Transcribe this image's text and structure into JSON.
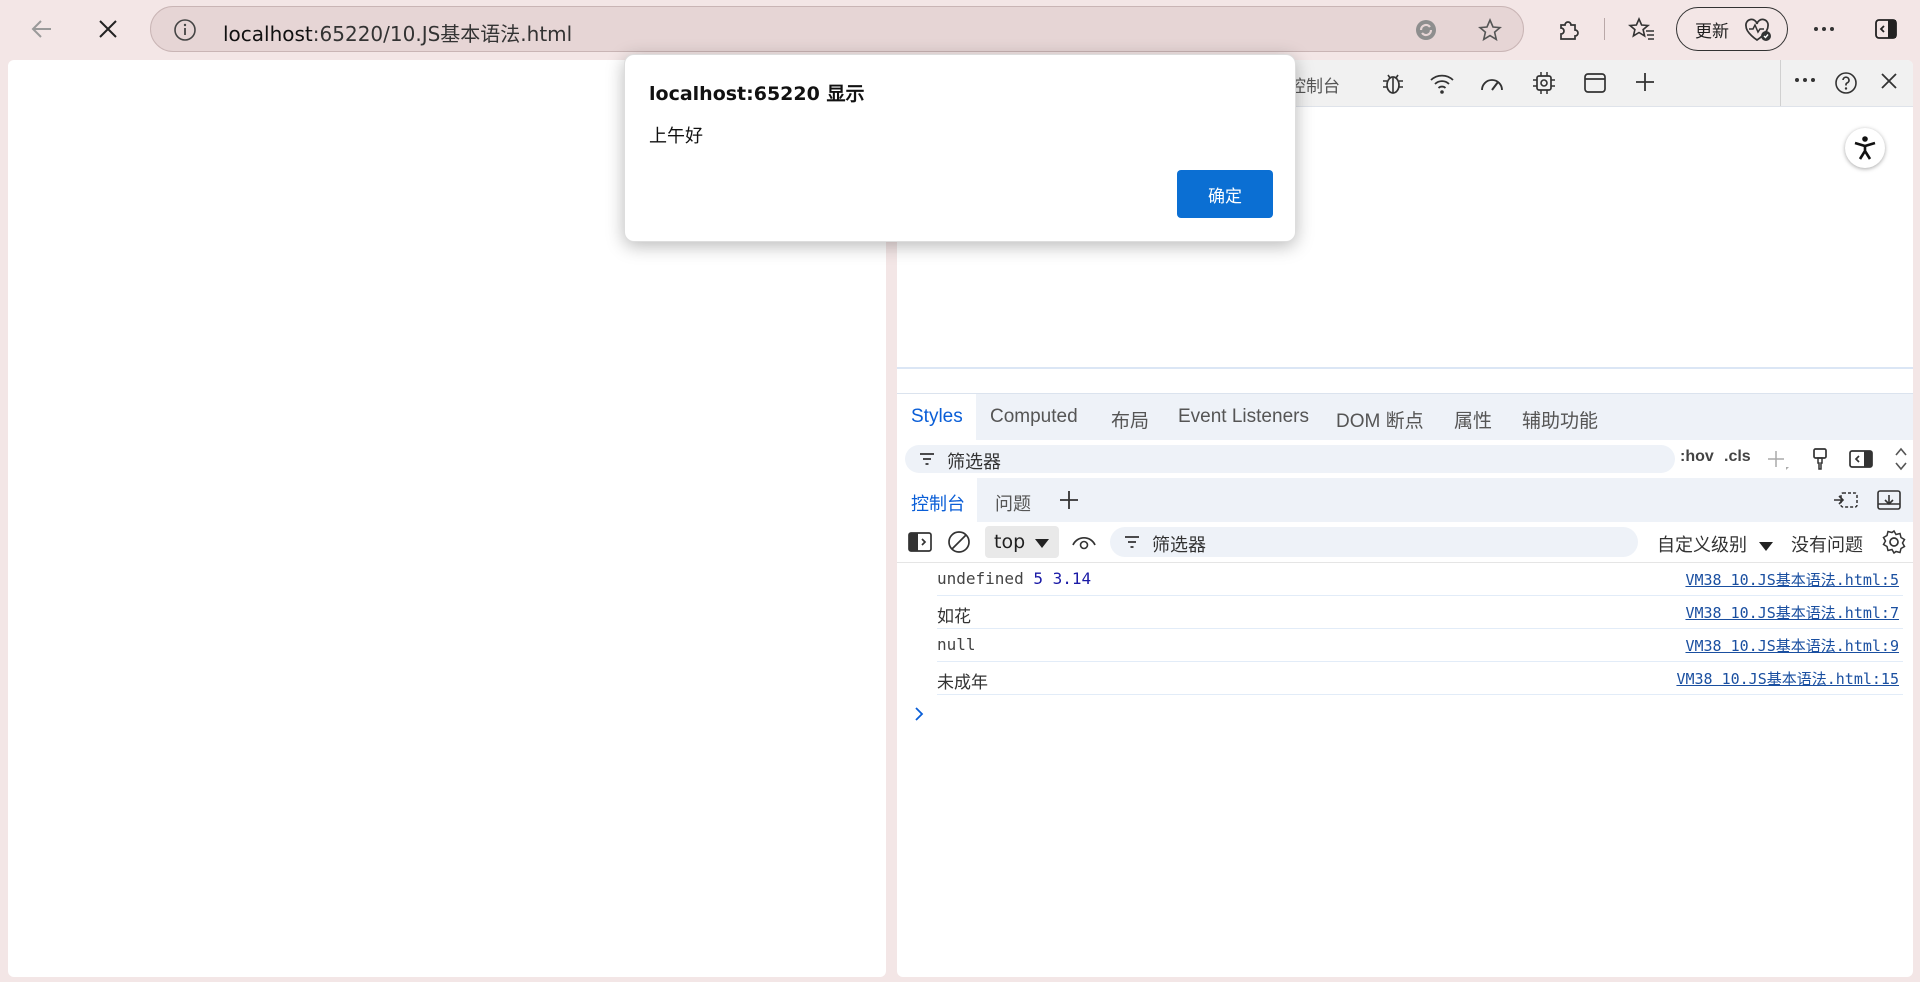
{
  "browser": {
    "url_host": "localhost",
    "url_rest": ":65220/10.JS基本语法.html",
    "update_label": "更新"
  },
  "devtools": {
    "top_tab_partial": "控制台",
    "styles_tabs": [
      "Styles",
      "Computed",
      "布局",
      "Event Listeners",
      "DOM 断点",
      "属性",
      "辅助功能"
    ],
    "styles_filter_placeholder": "筛选器",
    "hov_label": ":hov",
    "cls_label": ".cls",
    "console_tabs": [
      "控制台",
      "问题"
    ],
    "context": "top",
    "console_filter_placeholder": "筛选器",
    "levels_label": "自定义级别",
    "issues_label": "没有问题",
    "log": [
      {
        "text": "undefined",
        "nums": " 5 3.14",
        "source": "VM38 10.JS基本语法.html:5"
      },
      {
        "text": "如花",
        "nums": "",
        "source": "VM38 10.JS基本语法.html:7"
      },
      {
        "text": "null",
        "nums": "",
        "source": "VM38 10.JS基本语法.html:9"
      },
      {
        "text": "未成年",
        "nums": "",
        "source": "VM38 10.JS基本语法.html:15"
      }
    ]
  },
  "dialog": {
    "title": "localhost:65220 显示",
    "message": "上午好",
    "ok_label": "确定"
  }
}
